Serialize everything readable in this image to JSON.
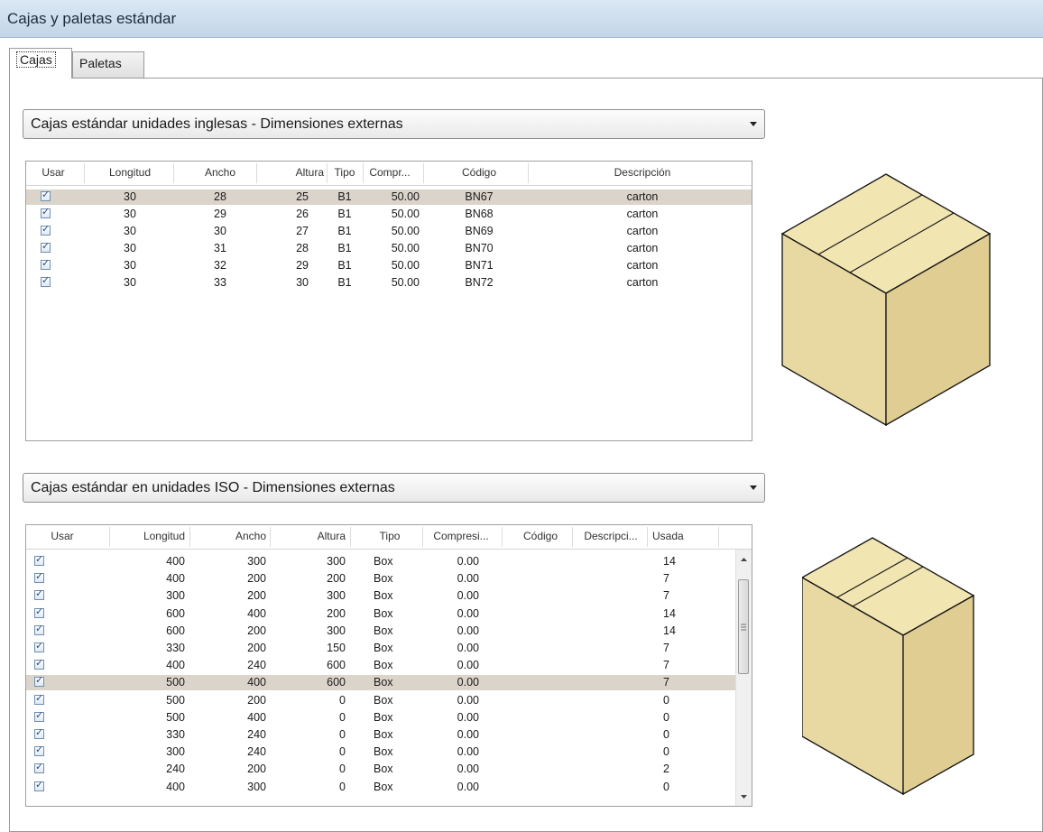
{
  "window": {
    "title": "Cajas y paletas estándar"
  },
  "tabs": [
    {
      "label": "Cajas",
      "active": true
    },
    {
      "label": "Paletas",
      "active": false
    }
  ],
  "english_section": {
    "selected": "Cajas estándar unidades inglesas - Dimensiones externas",
    "columns": [
      "Usar",
      "Longitud",
      "Ancho",
      "Altura",
      "Tipo",
      "Compr...",
      "Código",
      "Descripción"
    ],
    "rows": [
      {
        "usar": true,
        "longitud": "30",
        "ancho": "28",
        "altura": "25",
        "tipo": "B1",
        "compr": "50.00",
        "codigo": "BN67",
        "descripcion": "carton",
        "selected": true
      },
      {
        "usar": true,
        "longitud": "30",
        "ancho": "29",
        "altura": "26",
        "tipo": "B1",
        "compr": "50.00",
        "codigo": "BN68",
        "descripcion": "carton",
        "selected": false
      },
      {
        "usar": true,
        "longitud": "30",
        "ancho": "30",
        "altura": "27",
        "tipo": "B1",
        "compr": "50.00",
        "codigo": "BN69",
        "descripcion": "carton",
        "selected": false
      },
      {
        "usar": true,
        "longitud": "30",
        "ancho": "31",
        "altura": "28",
        "tipo": "B1",
        "compr": "50.00",
        "codigo": "BN70",
        "descripcion": "carton",
        "selected": false
      },
      {
        "usar": true,
        "longitud": "30",
        "ancho": "32",
        "altura": "29",
        "tipo": "B1",
        "compr": "50.00",
        "codigo": "BN71",
        "descripcion": "carton",
        "selected": false
      },
      {
        "usar": true,
        "longitud": "30",
        "ancho": "33",
        "altura": "30",
        "tipo": "B1",
        "compr": "50.00",
        "codigo": "BN72",
        "descripcion": "carton",
        "selected": false
      }
    ]
  },
  "iso_section": {
    "selected": "Cajas estándar en unidades ISO - Dimensiones externas",
    "columns": [
      "Usar",
      "Longitud",
      "Ancho",
      "Altura",
      "Tipo",
      "Compresi...",
      "Código",
      "Descripci...",
      "Usada"
    ],
    "rows": [
      {
        "usar": true,
        "longitud": "400",
        "ancho": "300",
        "altura": "300",
        "tipo": "Box",
        "compr": "0.00",
        "codigo": "",
        "descripcion": "",
        "usada": "14",
        "selected": false
      },
      {
        "usar": true,
        "longitud": "400",
        "ancho": "200",
        "altura": "200",
        "tipo": "Box",
        "compr": "0.00",
        "codigo": "",
        "descripcion": "",
        "usada": "7",
        "selected": false
      },
      {
        "usar": true,
        "longitud": "300",
        "ancho": "200",
        "altura": "300",
        "tipo": "Box",
        "compr": "0.00",
        "codigo": "",
        "descripcion": "",
        "usada": "7",
        "selected": false
      },
      {
        "usar": true,
        "longitud": "600",
        "ancho": "400",
        "altura": "200",
        "tipo": "Box",
        "compr": "0.00",
        "codigo": "",
        "descripcion": "",
        "usada": "14",
        "selected": false
      },
      {
        "usar": true,
        "longitud": "600",
        "ancho": "200",
        "altura": "300",
        "tipo": "Box",
        "compr": "0.00",
        "codigo": "",
        "descripcion": "",
        "usada": "14",
        "selected": false
      },
      {
        "usar": true,
        "longitud": "330",
        "ancho": "200",
        "altura": "150",
        "tipo": "Box",
        "compr": "0.00",
        "codigo": "",
        "descripcion": "",
        "usada": "7",
        "selected": false
      },
      {
        "usar": true,
        "longitud": "400",
        "ancho": "240",
        "altura": "600",
        "tipo": "Box",
        "compr": "0.00",
        "codigo": "",
        "descripcion": "",
        "usada": "7",
        "selected": false
      },
      {
        "usar": true,
        "longitud": "500",
        "ancho": "400",
        "altura": "600",
        "tipo": "Box",
        "compr": "0.00",
        "codigo": "",
        "descripcion": "",
        "usada": "7",
        "selected": true
      },
      {
        "usar": true,
        "longitud": "500",
        "ancho": "200",
        "altura": "0",
        "tipo": "Box",
        "compr": "0.00",
        "codigo": "",
        "descripcion": "",
        "usada": "0",
        "selected": false
      },
      {
        "usar": true,
        "longitud": "500",
        "ancho": "400",
        "altura": "0",
        "tipo": "Box",
        "compr": "0.00",
        "codigo": "",
        "descripcion": "",
        "usada": "0",
        "selected": false
      },
      {
        "usar": true,
        "longitud": "330",
        "ancho": "240",
        "altura": "0",
        "tipo": "Box",
        "compr": "0.00",
        "codigo": "",
        "descripcion": "",
        "usada": "0",
        "selected": false
      },
      {
        "usar": true,
        "longitud": "300",
        "ancho": "240",
        "altura": "0",
        "tipo": "Box",
        "compr": "0.00",
        "codigo": "",
        "descripcion": "",
        "usada": "0",
        "selected": false
      },
      {
        "usar": true,
        "longitud": "240",
        "ancho": "200",
        "altura": "0",
        "tipo": "Box",
        "compr": "0.00",
        "codigo": "",
        "descripcion": "",
        "usada": "2",
        "selected": false
      },
      {
        "usar": true,
        "longitud": "400",
        "ancho": "300",
        "altura": "0",
        "tipo": "Box",
        "compr": "0.00",
        "codigo": "",
        "descripcion": "",
        "usada": "0",
        "selected": false
      }
    ]
  },
  "colors": {
    "box_top": "#f1e5b2",
    "box_left": "#e8d9a2",
    "box_right": "#dfcd92",
    "selected_row": "#dbd4ca"
  }
}
